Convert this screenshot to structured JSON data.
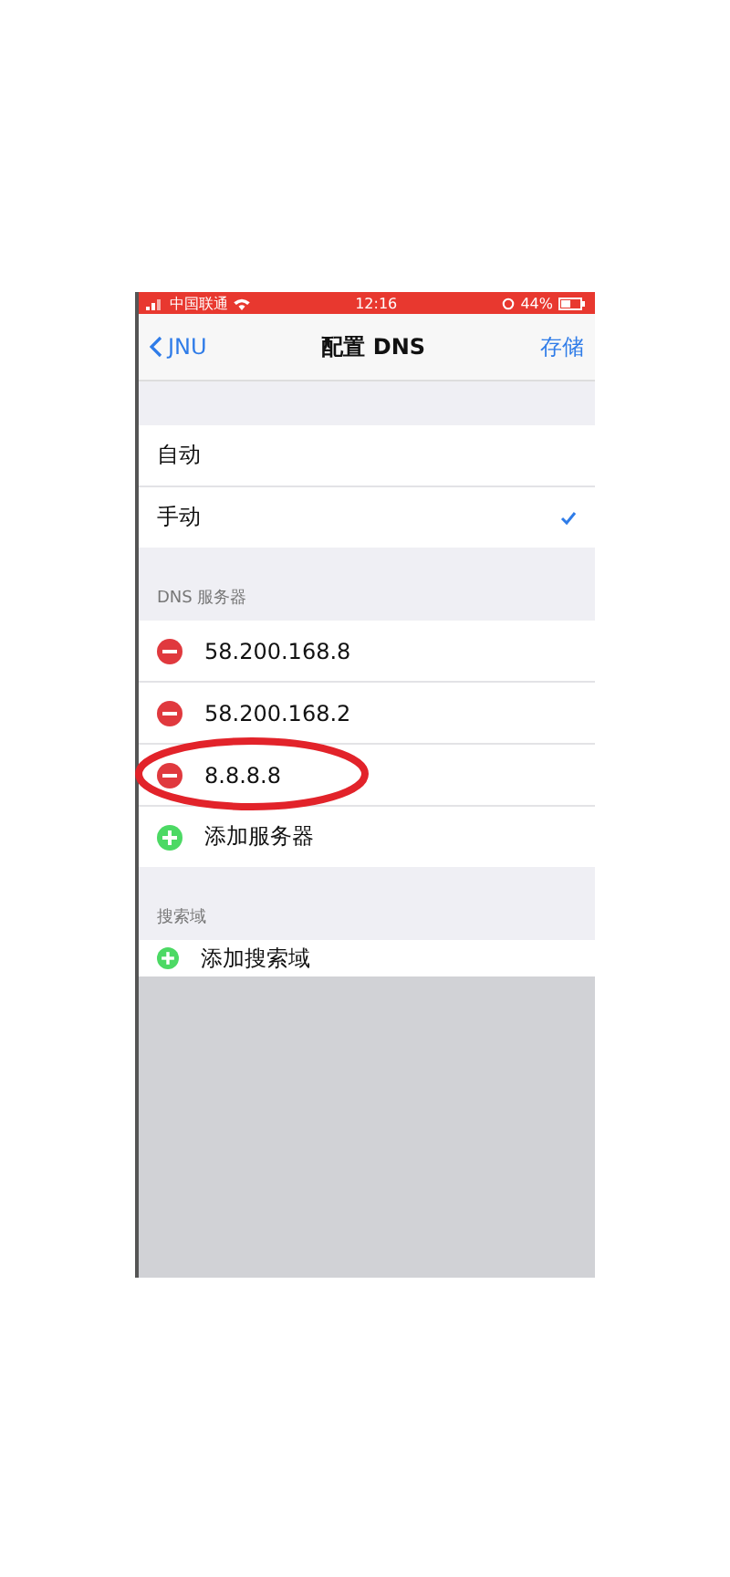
{
  "status_bar": {
    "carrier": "中国联通",
    "time": "12:16",
    "battery": "44%"
  },
  "nav": {
    "back": "JNU",
    "title": "配置 DNS",
    "action": "存储"
  },
  "modes": [
    {
      "label": "自动",
      "selected": false
    },
    {
      "label": "手动",
      "selected": true
    }
  ],
  "dns_section": {
    "header": "DNS 服务器",
    "servers": [
      {
        "address": "58.200.168.8",
        "highlighted": false
      },
      {
        "address": "58.200.168.2",
        "highlighted": false
      },
      {
        "address": "8.8.8.8",
        "highlighted": true
      }
    ],
    "add": "添加服务器"
  },
  "search_section": {
    "header": "搜索域",
    "add": "添加搜索域"
  }
}
